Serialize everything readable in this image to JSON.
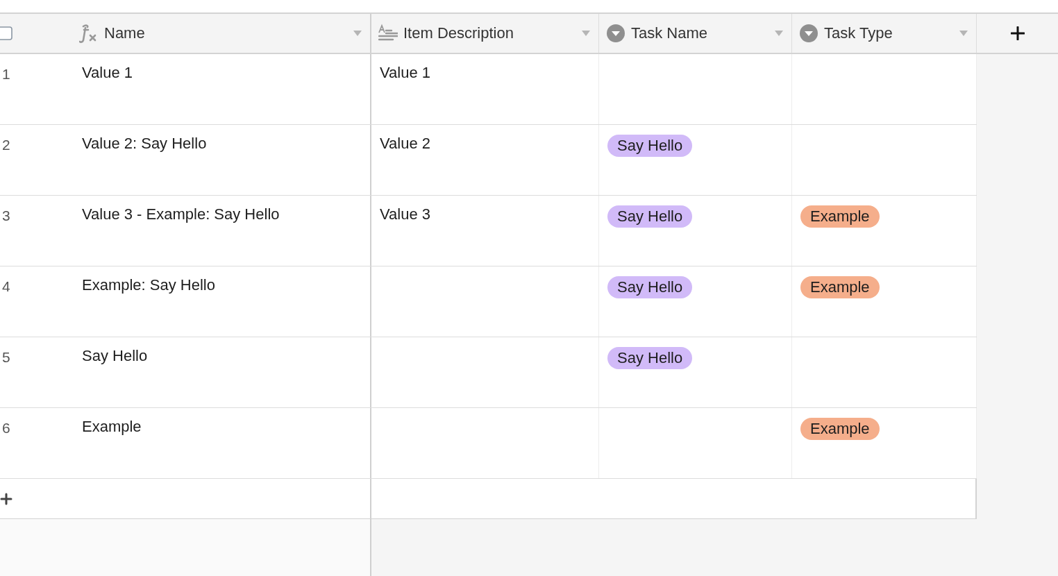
{
  "select_all": {
    "checked": false
  },
  "columns": [
    {
      "label": "Name",
      "kind": "formula"
    },
    {
      "label": "Item Description",
      "kind": "text"
    },
    {
      "label": "Task Name",
      "kind": "select"
    },
    {
      "label": "Task Type",
      "kind": "select"
    }
  ],
  "rows": [
    {
      "number": "1",
      "name": "Value 1",
      "description": "Value 1",
      "task_name": [],
      "task_type": []
    },
    {
      "number": "2",
      "name": "Value 2: Say Hello",
      "description": "Value 2",
      "task_name": [
        {
          "label": "Say Hello",
          "color": "#d1baf8"
        }
      ],
      "task_type": []
    },
    {
      "number": "3",
      "name": "Value 3 - Example: Say Hello",
      "description": "Value 3",
      "task_name": [
        {
          "label": "Say Hello",
          "color": "#d1baf8"
        }
      ],
      "task_type": [
        {
          "label": "Example",
          "color": "#f5ae8b"
        }
      ]
    },
    {
      "number": "4",
      "name": "Example: Say Hello",
      "description": "",
      "task_name": [
        {
          "label": "Say Hello",
          "color": "#d1baf8"
        }
      ],
      "task_type": [
        {
          "label": "Example",
          "color": "#f5ae8b"
        }
      ]
    },
    {
      "number": "5",
      "name": "Say Hello",
      "description": "",
      "task_name": [
        {
          "label": "Say Hello",
          "color": "#d1baf8"
        }
      ],
      "task_type": []
    },
    {
      "number": "6",
      "name": "Example",
      "description": "",
      "task_name": [],
      "task_type": [
        {
          "label": "Example",
          "color": "#f5ae8b"
        }
      ]
    }
  ]
}
